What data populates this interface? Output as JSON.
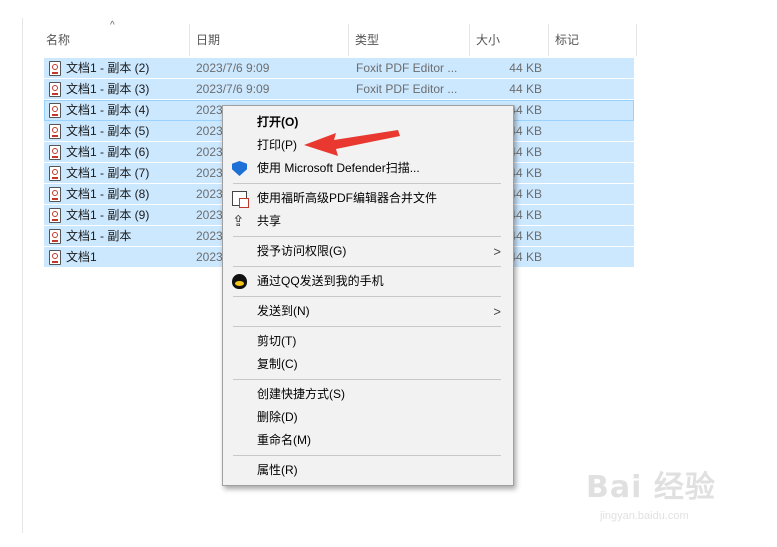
{
  "columns": {
    "name": "名称",
    "date": "日期",
    "type": "类型",
    "size": "大小",
    "tags": "标记"
  },
  "files": [
    {
      "name": "文档1 - 副本 (2)",
      "date": "2023/7/6 9:09",
      "type": "Foxit PDF Editor ...",
      "size": "44 KB"
    },
    {
      "name": "文档1 - 副本 (3)",
      "date": "2023/7/6 9:09",
      "type": "Foxit PDF Editor ...",
      "size": "44 KB"
    },
    {
      "name": "文档1 - 副本 (4)",
      "date": "2023",
      "type": "",
      "size": "44 KB"
    },
    {
      "name": "文档1 - 副本 (5)",
      "date": "2023",
      "type": "",
      "size": "44 KB"
    },
    {
      "name": "文档1 - 副本 (6)",
      "date": "2023",
      "type": "",
      "size": "44 KB"
    },
    {
      "name": "文档1 - 副本 (7)",
      "date": "2023",
      "type": "",
      "size": "44 KB"
    },
    {
      "name": "文档1 - 副本 (8)",
      "date": "2023",
      "type": "",
      "size": "44 KB"
    },
    {
      "name": "文档1 - 副本 (9)",
      "date": "2023",
      "type": "",
      "size": "44 KB"
    },
    {
      "name": "文档1 - 副本",
      "date": "2023",
      "type": "",
      "size": "44 KB"
    },
    {
      "name": "文档1",
      "date": "2023",
      "type": "",
      "size": "44 KB"
    }
  ],
  "context_menu": {
    "open": "打开(O)",
    "print": "打印(P)",
    "defender": "使用 Microsoft Defender扫描...",
    "merge_pdf": "使用福昕高级PDF编辑器合并文件",
    "share": "共享",
    "grant_access": "授予访问权限(G)",
    "send_qq": "通过QQ发送到我的手机",
    "send_to": "发送到(N)",
    "cut": "剪切(T)",
    "copy": "复制(C)",
    "create_shortcut": "创建快捷方式(S)",
    "delete": "删除(D)",
    "rename": "重命名(M)",
    "properties": "属性(R)"
  },
  "icons": {
    "file": "pdf-file-icon",
    "defender": "shield-icon",
    "merge": "pdf-merge-icon",
    "share": "share-icon",
    "qq": "qq-penguin-icon",
    "submenu": "chevron-right-icon",
    "sort": "sort-ascending-icon"
  },
  "colors": {
    "selection": "#cce8ff",
    "menu_bg": "#f2f2f2",
    "annotation": "#e8382f"
  },
  "watermark": {
    "main": "Bai 经验",
    "sub": "jingyan.baidu.com"
  }
}
